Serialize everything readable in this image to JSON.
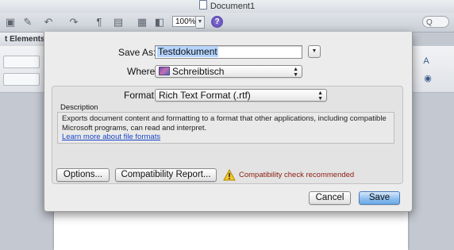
{
  "window": {
    "title": "Document1",
    "zoom": "100%",
    "ribbon_tab": "t Elements",
    "search_glyph": "Q"
  },
  "dialog": {
    "save_as_label": "Save As:",
    "save_as_value": "Testdokument",
    "where_label": "Where:",
    "where_value": "Schreibtisch",
    "format_label": "Format:",
    "format_value": "Rich Text Format (.rtf)",
    "description_heading": "Description",
    "description_text": "Exports document content and formatting to a format that other applications, including compatible Microsoft programs, can read and interpret.",
    "learn_more_link": "Learn more about file formats",
    "options_button": "Options...",
    "compat_button": "Compatibility Report...",
    "warning_text": "Compatibility check recommended",
    "cancel_button": "Cancel",
    "save_button": "Save"
  },
  "colors": {
    "default_button": "#6aa9e6",
    "warning_text": "#8c1c10",
    "link": "#1a46c8"
  }
}
